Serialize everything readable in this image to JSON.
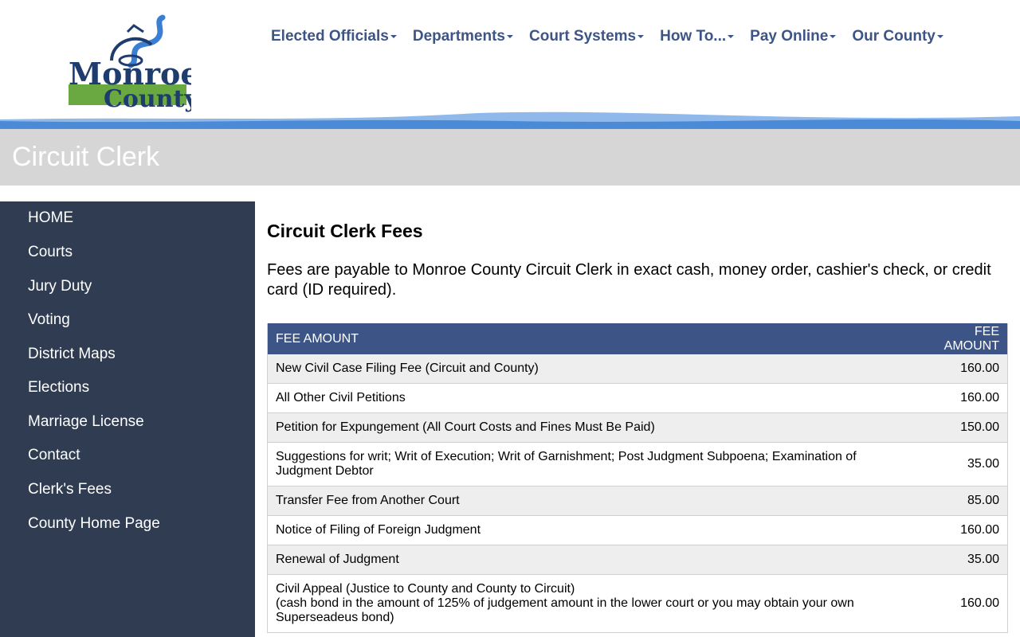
{
  "logo": {
    "line1": "Monroe",
    "line2": "County"
  },
  "nav": [
    {
      "label": "Elected Officials"
    },
    {
      "label": "Departments"
    },
    {
      "label": "Court Systems"
    },
    {
      "label": "How To..."
    },
    {
      "label": "Pay Online"
    },
    {
      "label": "Our County"
    }
  ],
  "page_title": "Circuit Clerk",
  "sidebar": [
    {
      "label": "HOME"
    },
    {
      "label": "Courts"
    },
    {
      "label": "Jury Duty"
    },
    {
      "label": "Voting"
    },
    {
      "label": "District Maps"
    },
    {
      "label": "Elections"
    },
    {
      "label": "Marriage License"
    },
    {
      "label": "Contact"
    },
    {
      "label": "Clerk's Fees"
    },
    {
      "label": "County Home Page"
    }
  ],
  "content": {
    "heading": "Circuit Clerk Fees",
    "intro": "Fees are payable to Monroe County Circuit Clerk in exact cash, money order, cashier's check, or credit card (ID required).",
    "table": {
      "headers": [
        "FEE AMOUNT",
        "FEE AMOUNT"
      ],
      "rows": [
        {
          "desc": "New Civil Case Filing Fee (Circuit and County)",
          "amount": "160.00"
        },
        {
          "desc": "All Other Civil Petitions",
          "amount": "160.00"
        },
        {
          "desc": "Petition for Expungement (All Court Costs and Fines Must Be Paid)",
          "amount": "150.00"
        },
        {
          "desc": "Suggestions for writ; Writ of Execution; Writ of Garnishment; Post Judgment Subpoena; Examination of Judgment Debtor",
          "amount": "35.00"
        },
        {
          "desc": "Transfer Fee from Another Court",
          "amount": "85.00"
        },
        {
          "desc": "Notice of Filing of Foreign Judgment",
          "amount": "160.00"
        },
        {
          "desc": "Renewal of Judgment",
          "amount": "35.00"
        },
        {
          "desc": "Civil Appeal (Justice to County and County to Circuit)",
          "desc2": "(cash bond in the amount of 125% of judgement amount in the lower court or you may obtain your own Superseadeus bond)",
          "amount": "160.00"
        }
      ]
    }
  },
  "colors": {
    "nav": "#3c5586",
    "sidebar": "#2f3c52",
    "title_bar": "#d6d6d6",
    "table_header": "#3c5586",
    "wave": "#4a8ad6"
  }
}
